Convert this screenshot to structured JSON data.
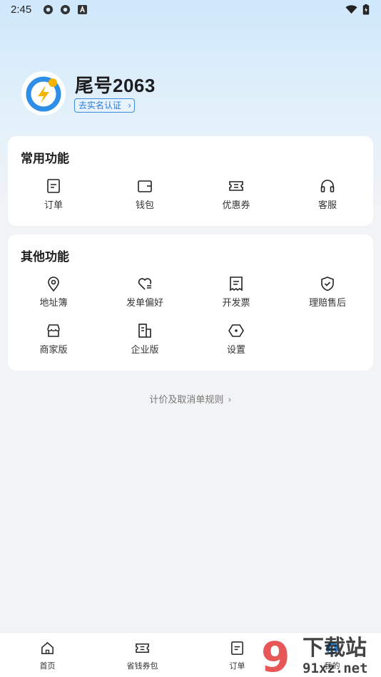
{
  "status_bar": {
    "time": "2:45"
  },
  "profile": {
    "username": "尾号2063",
    "verify_label": "去实名认证",
    "verify_chevron": "›"
  },
  "common_functions": {
    "title": "常用功能",
    "items": [
      {
        "label": "订单",
        "icon": "order-icon"
      },
      {
        "label": "钱包",
        "icon": "wallet-icon"
      },
      {
        "label": "优惠券",
        "icon": "coupon-icon"
      },
      {
        "label": "客服",
        "icon": "headset-icon"
      }
    ]
  },
  "other_functions": {
    "title": "其他功能",
    "items": [
      {
        "label": "地址簿",
        "icon": "location-pin-icon"
      },
      {
        "label": "发单偏好",
        "icon": "heart-list-icon"
      },
      {
        "label": "开发票",
        "icon": "invoice-icon"
      },
      {
        "label": "理赔售后",
        "icon": "shield-check-icon"
      },
      {
        "label": "商家版",
        "icon": "store-icon"
      },
      {
        "label": "企业版",
        "icon": "building-icon"
      },
      {
        "label": "设置",
        "icon": "settings-hexagon-icon"
      }
    ]
  },
  "pricing_link": {
    "label": "计价及取消单规则",
    "chevron": "›"
  },
  "tab_bar": {
    "items": [
      {
        "label": "首页",
        "icon": "home-icon"
      },
      {
        "label": "省钱券包",
        "icon": "coupon-icon"
      },
      {
        "label": "订单",
        "icon": "order-icon"
      },
      {
        "label": "我的",
        "icon": "profile-icon"
      }
    ]
  },
  "watermark": {
    "text_top": "下载站",
    "text_bottom": "91xz.net"
  },
  "colors": {
    "accent": "#2a7ad6",
    "brand_blue": "#2f8fe6",
    "brand_yellow": "#f5b400",
    "background": "#f2f3f5"
  }
}
